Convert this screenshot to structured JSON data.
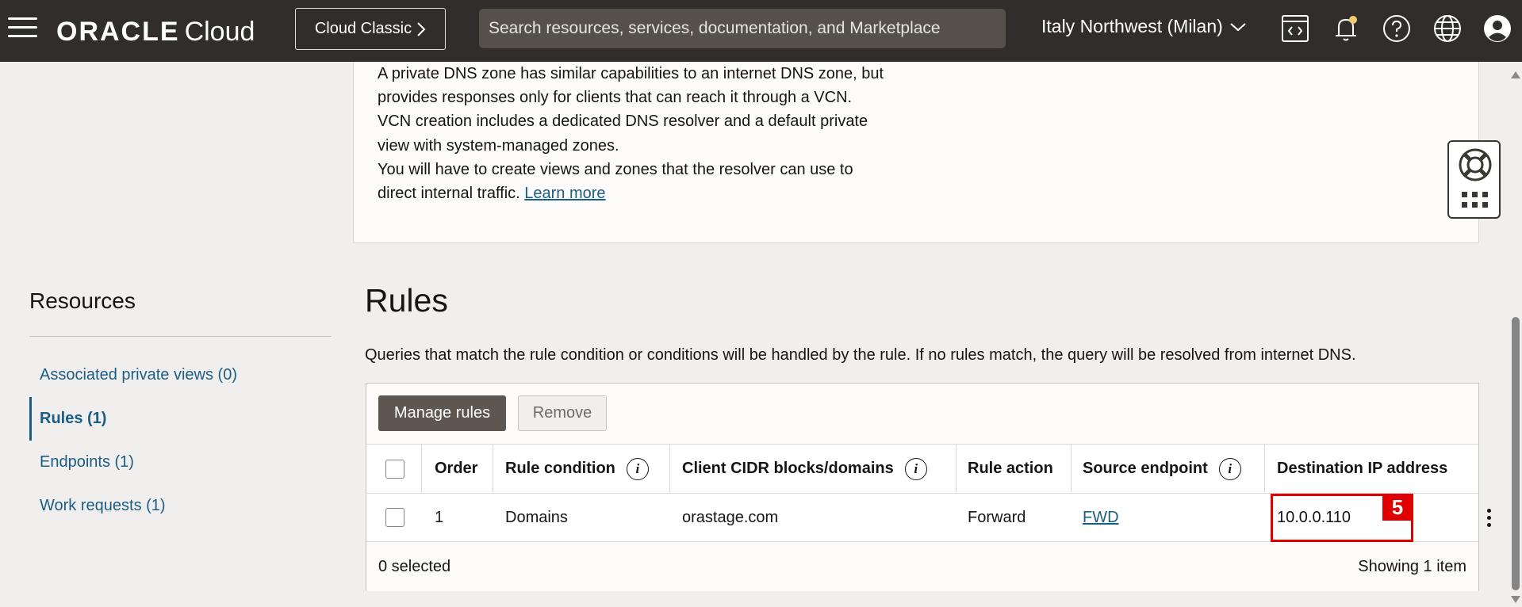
{
  "topbar": {
    "logo_brand": "ORACLE",
    "logo_product": "Cloud",
    "classic_label": "Cloud Classic",
    "search_placeholder": "Search resources, services, documentation, and Marketplace",
    "region": "Italy Northwest (Milan)",
    "icons": [
      "menu-icon",
      "code-editor-icon",
      "bell-icon",
      "help-icon",
      "globe-icon",
      "user-avatar-icon"
    ]
  },
  "info": {
    "lines": [
      "A private DNS zone has similar capabilities to an internet DNS zone, but",
      "provides responses only for clients that can reach it through a VCN.",
      "VCN creation includes a dedicated DNS resolver and a default private",
      "view with system-managed zones.",
      "You will have to create views and zones that the resolver can use to"
    ],
    "last_line": "direct internal traffic.",
    "learn_more": "Learn more"
  },
  "resources": {
    "title": "Resources",
    "items": [
      {
        "label": "Associated private views (0)",
        "active": false
      },
      {
        "label": "Rules (1)",
        "active": true
      },
      {
        "label": "Endpoints (1)",
        "active": false
      },
      {
        "label": "Work requests (1)",
        "active": false
      }
    ]
  },
  "rules": {
    "title": "Rules",
    "description": "Queries that match the rule condition or conditions will be handled by the rule. If no rules match, the query will be resolved from internet DNS.",
    "manage_label": "Manage rules",
    "remove_label": "Remove",
    "columns": {
      "order": "Order",
      "condition": "Rule condition",
      "cidr": "Client CIDR blocks/domains",
      "action": "Rule action",
      "source": "Source endpoint",
      "destination": "Destination IP address"
    },
    "row": {
      "order": "1",
      "condition": "Domains",
      "cidr": "orastage.com",
      "action": "Forward",
      "source": "FWD",
      "destination": "10.0.0.110"
    },
    "step_badge": "5",
    "selected": "0 selected",
    "showing": "Showing 1 item"
  },
  "colors": {
    "nav_bg": "#312d2a",
    "link": "#1a5d85",
    "highlight": "#e00000",
    "primary_btn": "#5d5651"
  }
}
